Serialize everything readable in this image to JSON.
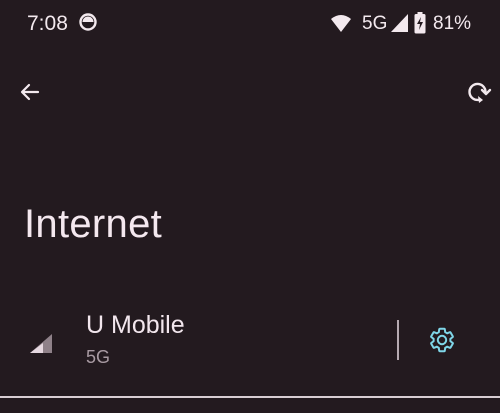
{
  "status_bar": {
    "time": "7:08",
    "network_type": "5G",
    "battery_percent": "81%",
    "icons": [
      "app-notification-icon",
      "wifi-icon",
      "cell-signal-icon",
      "battery-charging-icon"
    ]
  },
  "toolbar": {
    "back_icon": "arrow-left-icon",
    "reset_icon": "network-reset-icon"
  },
  "page": {
    "title": "Internet"
  },
  "network": {
    "name": "U Mobile",
    "type": "5G",
    "signal_icon": "cell-signal-icon",
    "settings_icon": "gear-icon"
  },
  "colors": {
    "background": "#231a1f",
    "text_primary": "#f2e6ed",
    "text_secondary": "#a89aa2",
    "accent": "#7fd6e8"
  }
}
